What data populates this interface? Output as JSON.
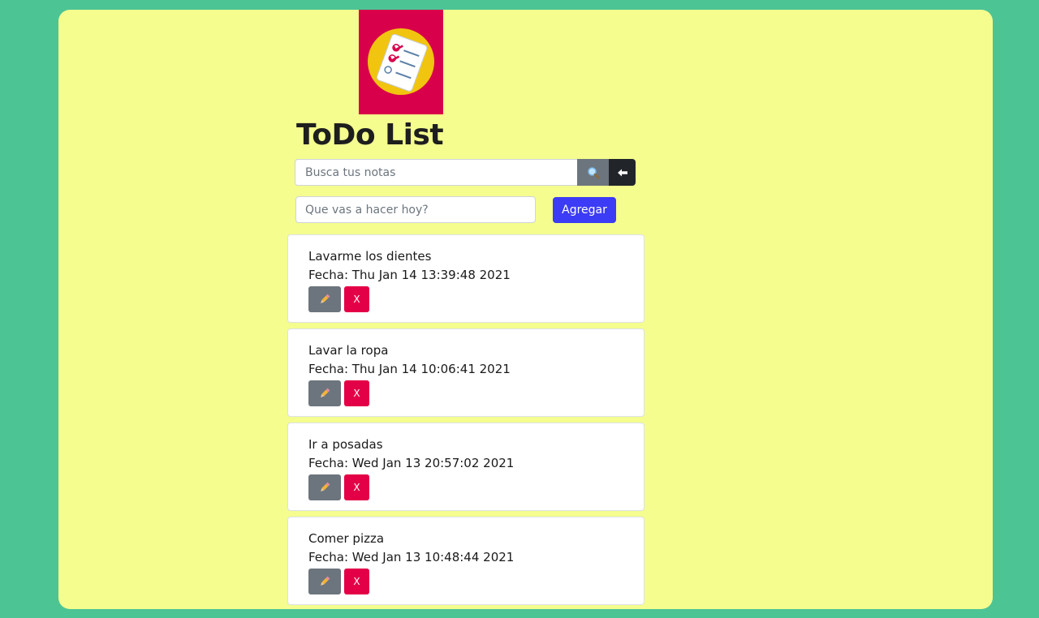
{
  "app": {
    "title": "ToDo List",
    "logo_icon": "checklist-icon"
  },
  "colors": {
    "page_background": "#4dc494",
    "panel_background": "#f4fd8e",
    "logo_background": "#d8004a",
    "add_button": "#3c3bf5",
    "edit_button": "#6c757d",
    "delete_button": "#e30047",
    "back_button": "#212529"
  },
  "search": {
    "placeholder": "Busca tus notas",
    "value": "",
    "search_icon": "magnifier-icon",
    "back_icon": "arrow-left-icon"
  },
  "new_task": {
    "placeholder": "Que vas a hacer hoy?",
    "value": "",
    "add_label": "Agregar"
  },
  "tasks": [
    {
      "title": "Lavarme los dientes",
      "date": "Fecha: Thu Jan 14 13:39:48 2021",
      "edit_icon": "pencil-icon",
      "delete_label": "X"
    },
    {
      "title": "Lavar la ropa",
      "date": "Fecha: Thu Jan 14 10:06:41 2021",
      "edit_icon": "pencil-icon",
      "delete_label": "X"
    },
    {
      "title": "Ir a posadas",
      "date": "Fecha: Wed Jan 13 20:57:02 2021",
      "edit_icon": "pencil-icon",
      "delete_label": "X"
    },
    {
      "title": "Comer pizza",
      "date": "Fecha: Wed Jan 13 10:48:44 2021",
      "edit_icon": "pencil-icon",
      "delete_label": "X"
    }
  ]
}
